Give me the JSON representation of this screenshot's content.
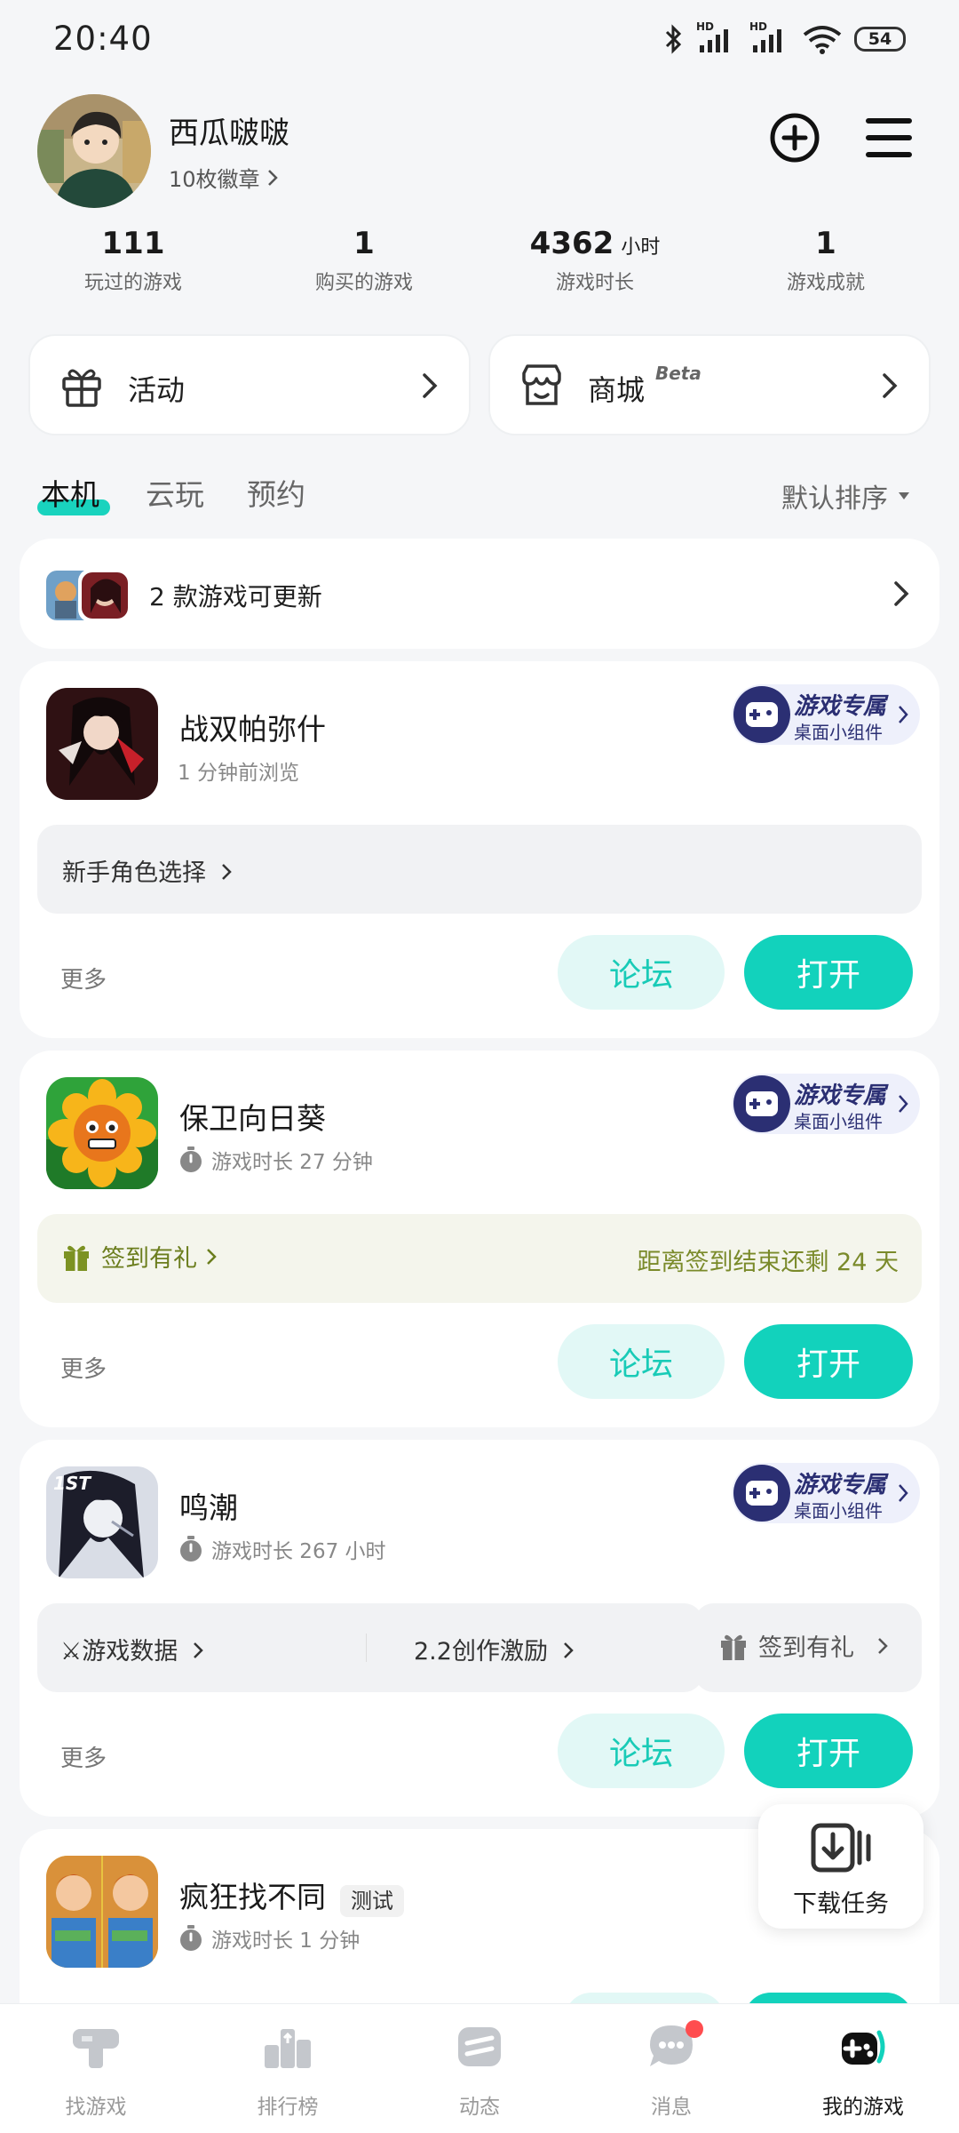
{
  "status_bar": {
    "time": "20:40",
    "battery": "54",
    "hd1": "HD",
    "hd2": "HD"
  },
  "profile": {
    "username": "西瓜啵啵",
    "badges": "10枚徽章"
  },
  "stats": [
    {
      "value": "111",
      "unit": "",
      "label": "玩过的游戏"
    },
    {
      "value": "1",
      "unit": "",
      "label": "购买的游戏"
    },
    {
      "value": "4362",
      "unit": "小时",
      "label": "游戏时长"
    },
    {
      "value": "1",
      "unit": "",
      "label": "游戏成就"
    }
  ],
  "quick": {
    "activity": "活动",
    "mall": "商城",
    "mall_tag": "Beta"
  },
  "tabs": {
    "local": "本机",
    "cloud": "云玩",
    "reserve": "预约",
    "sort": "默认排序"
  },
  "update_banner": {
    "text": "2 款游戏可更新"
  },
  "widget": {
    "line1": "游戏专属",
    "line2": "桌面小组件"
  },
  "games": [
    {
      "title": "战双帕弥什",
      "subtitle": "1 分钟前浏览",
      "row_text": "新手角色选择",
      "more": "更多",
      "forum": "论坛",
      "open": "打开"
    },
    {
      "title": "保卫向日葵",
      "subtitle": "游戏时长 27 分钟",
      "checkin_label": "签到有礼",
      "checkin_note": "距离签到结束还剩 24 天",
      "more": "更多",
      "forum": "论坛",
      "open": "打开"
    },
    {
      "title": "鸣潮",
      "subtitle": "游戏时长 267 小时",
      "link1": "⚔游戏数据",
      "link2": "2.2创作激励",
      "checkin_label": "签到有礼",
      "more": "更多",
      "forum": "论坛",
      "open": "打开"
    },
    {
      "title": "疯狂找不同",
      "tag": "测试",
      "subtitle": "游戏时长 1 分钟"
    }
  ],
  "download": {
    "label": "下载任务"
  },
  "bottom_nav": [
    {
      "label": "找游戏"
    },
    {
      "label": "排行榜"
    },
    {
      "label": "动态"
    },
    {
      "label": "消息"
    },
    {
      "label": "我的游戏"
    }
  ],
  "colors": {
    "accent": "#12d2bc",
    "forum_bg": "#e2f8f6",
    "widget_text": "#2b2f73",
    "checkin": "#6b7d1d",
    "notify_dot": "#ff4d4f"
  }
}
